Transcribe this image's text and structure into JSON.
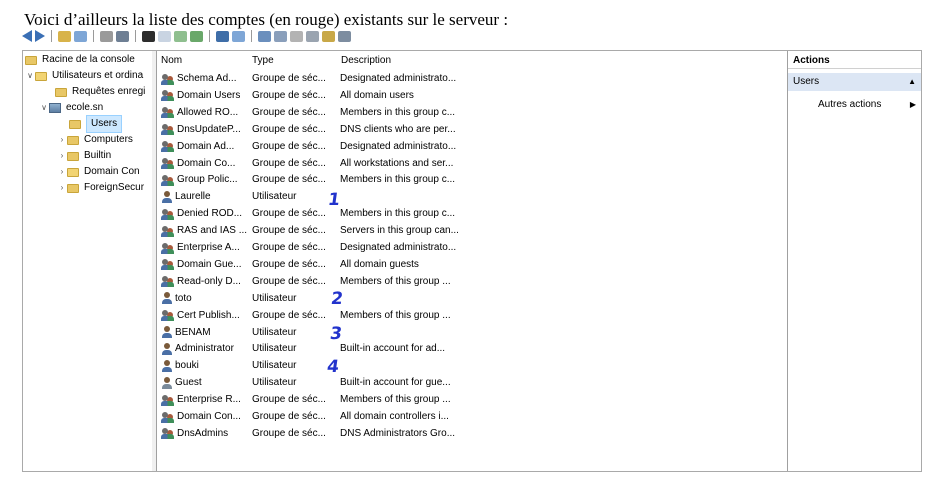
{
  "caption": "Voici d’ailleurs la liste des comptes (en rouge) existants sur le serveur :",
  "tree": {
    "root": "Racine de la console",
    "snapin": "Utilisateurs et ordina",
    "saved_queries": "Requêtes enregi",
    "domain": "ecole.sn",
    "users": "Users",
    "computers": "Computers",
    "builtin": "Builtin",
    "domain_controllers": "Domain Con",
    "foreign": "ForeignSecur"
  },
  "list": {
    "headers": {
      "name": "Nom",
      "type": "Type",
      "description": "Description"
    },
    "rows": [
      {
        "icon": "group-icon",
        "name": "Schema Ad...",
        "type": "Groupe de séc...",
        "description": "Designated administrato..."
      },
      {
        "icon": "group-icon",
        "name": "Domain Users",
        "type": "Groupe de séc...",
        "description": "All domain users"
      },
      {
        "icon": "group-icon",
        "name": "Allowed RO...",
        "type": "Groupe de séc...",
        "description": "Members in this group c..."
      },
      {
        "icon": "group-icon",
        "name": "DnsUpdateP...",
        "type": "Groupe de séc...",
        "description": "DNS clients who are per..."
      },
      {
        "icon": "group-icon",
        "name": "Domain Ad...",
        "type": "Groupe de séc...",
        "description": "Designated administrato..."
      },
      {
        "icon": "group-icon",
        "name": "Domain Co...",
        "type": "Groupe de séc...",
        "description": "All workstations and ser..."
      },
      {
        "icon": "group-icon",
        "name": "Group Polic...",
        "type": "Groupe de séc...",
        "description": "Members in this group c..."
      },
      {
        "icon": "user-icon",
        "name": "Laurelle",
        "type": "Utilisateur",
        "description": ""
      },
      {
        "icon": "group-icon",
        "name": "Denied ROD...",
        "type": "Groupe de séc...",
        "description": "Members in this group c..."
      },
      {
        "icon": "group-icon",
        "name": "RAS and IAS ...",
        "type": "Groupe de séc...",
        "description": "Servers in this group can..."
      },
      {
        "icon": "group-icon",
        "name": "Enterprise A...",
        "type": "Groupe de séc...",
        "description": "Designated administrato..."
      },
      {
        "icon": "group-icon",
        "name": "Domain Gue...",
        "type": "Groupe de séc...",
        "description": "All domain guests"
      },
      {
        "icon": "group-icon",
        "name": "Read-only D...",
        "type": "Groupe de séc...",
        "description": "Members of this group ..."
      },
      {
        "icon": "user-icon",
        "name": "toto",
        "type": "Utilisateur",
        "description": ""
      },
      {
        "icon": "group-icon",
        "name": "Cert Publish...",
        "type": "Groupe de séc...",
        "description": "Members of this group ..."
      },
      {
        "icon": "user-icon",
        "name": "BENAM",
        "type": "Utilisateur",
        "description": ""
      },
      {
        "icon": "user-icon",
        "name": "Administrator",
        "type": "Utilisateur",
        "description": "Built-in account for ad..."
      },
      {
        "icon": "user-icon",
        "name": "bouki",
        "type": "Utilisateur",
        "description": ""
      },
      {
        "icon": "guest-user-icon",
        "name": "Guest",
        "type": "Utilisateur",
        "description": "Built-in account for gue..."
      },
      {
        "icon": "group-icon",
        "name": "Enterprise R...",
        "type": "Groupe de séc...",
        "description": "Members of this group ..."
      },
      {
        "icon": "group-icon",
        "name": "Domain Con...",
        "type": "Groupe de séc...",
        "description": "All domain controllers i..."
      },
      {
        "icon": "group-icon",
        "name": "DnsAdmins",
        "type": "Groupe de séc...",
        "description": "DNS Administrators Gro..."
      }
    ]
  },
  "annotations": [
    "1",
    "2",
    "3",
    "4"
  ],
  "actions": {
    "title": "Actions",
    "section": "Users",
    "more": "Autres actions"
  },
  "colors": {
    "annotation": "#2233cc",
    "selection": "#cde8ff"
  }
}
